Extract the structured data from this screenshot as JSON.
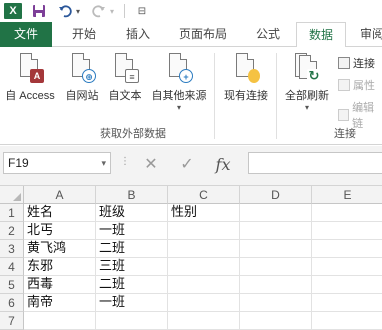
{
  "quick_access": {
    "app_icon": "X",
    "items": [
      "save-icon",
      "undo-icon",
      "redo-icon",
      "customize-icon"
    ]
  },
  "tabs": {
    "file": "文件",
    "items": [
      "开始",
      "插入",
      "页面布局",
      "公式",
      "数据",
      "审阅"
    ],
    "active": "数据"
  },
  "ribbon": {
    "get_external_data": {
      "label": "获取外部数据",
      "buttons": [
        "自 Access",
        "自网站",
        "自文本",
        "自其他来源"
      ]
    },
    "existing_connections": "现有连接",
    "refresh_all": "全部刷新",
    "connections": {
      "label": "连接",
      "items": [
        "连接",
        "属性",
        "编辑链"
      ]
    }
  },
  "formula_bar": {
    "name_box": "F19",
    "cancel": "✕",
    "enter": "✓",
    "fx": "fx",
    "value": ""
  },
  "sheet": {
    "columns": [
      "A",
      "B",
      "C",
      "D",
      "E"
    ],
    "rows": [
      "1",
      "2",
      "3",
      "4",
      "5",
      "6",
      "7"
    ],
    "cells": [
      [
        "姓名",
        "班级",
        "性别",
        "",
        ""
      ],
      [
        "北丐",
        "一班",
        "",
        "",
        ""
      ],
      [
        "黄飞鸿",
        "二班",
        "",
        "",
        ""
      ],
      [
        "东邪",
        "三班",
        "",
        "",
        ""
      ],
      [
        "西毒",
        "二班",
        "",
        "",
        ""
      ],
      [
        "南帝",
        "一班",
        "",
        "",
        ""
      ],
      [
        "",
        "",
        "",
        "",
        ""
      ]
    ]
  },
  "colors": {
    "excel_green": "#217346",
    "access_red": "#a4373a",
    "header_gray": "#f3f3f3"
  }
}
